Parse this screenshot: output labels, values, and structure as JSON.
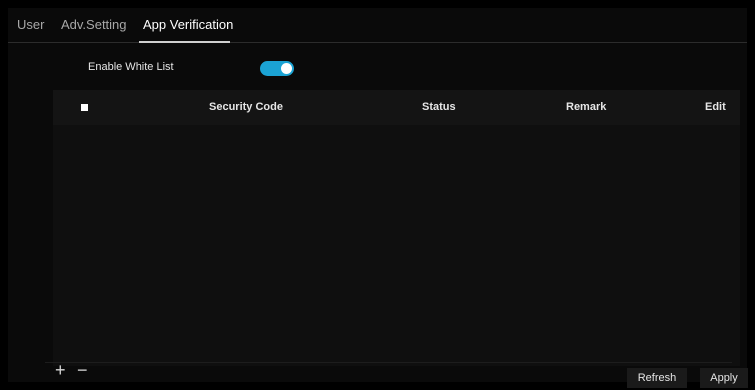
{
  "tabs": [
    {
      "label": "User"
    },
    {
      "label": "Adv.Setting"
    },
    {
      "label": "App Verification"
    }
  ],
  "whitelist": {
    "label": "Enable White List",
    "enabled": true
  },
  "table": {
    "columns": [
      "Security Code",
      "Status",
      "Remark",
      "Edit"
    ],
    "rows": []
  },
  "footer": {
    "add_icon": "plus-icon",
    "remove_icon": "minus-icon",
    "refresh_label": "Refresh",
    "apply_label": "Apply"
  },
  "colors": {
    "accent": "#1ba3d4",
    "background": "#0a0a0a"
  }
}
